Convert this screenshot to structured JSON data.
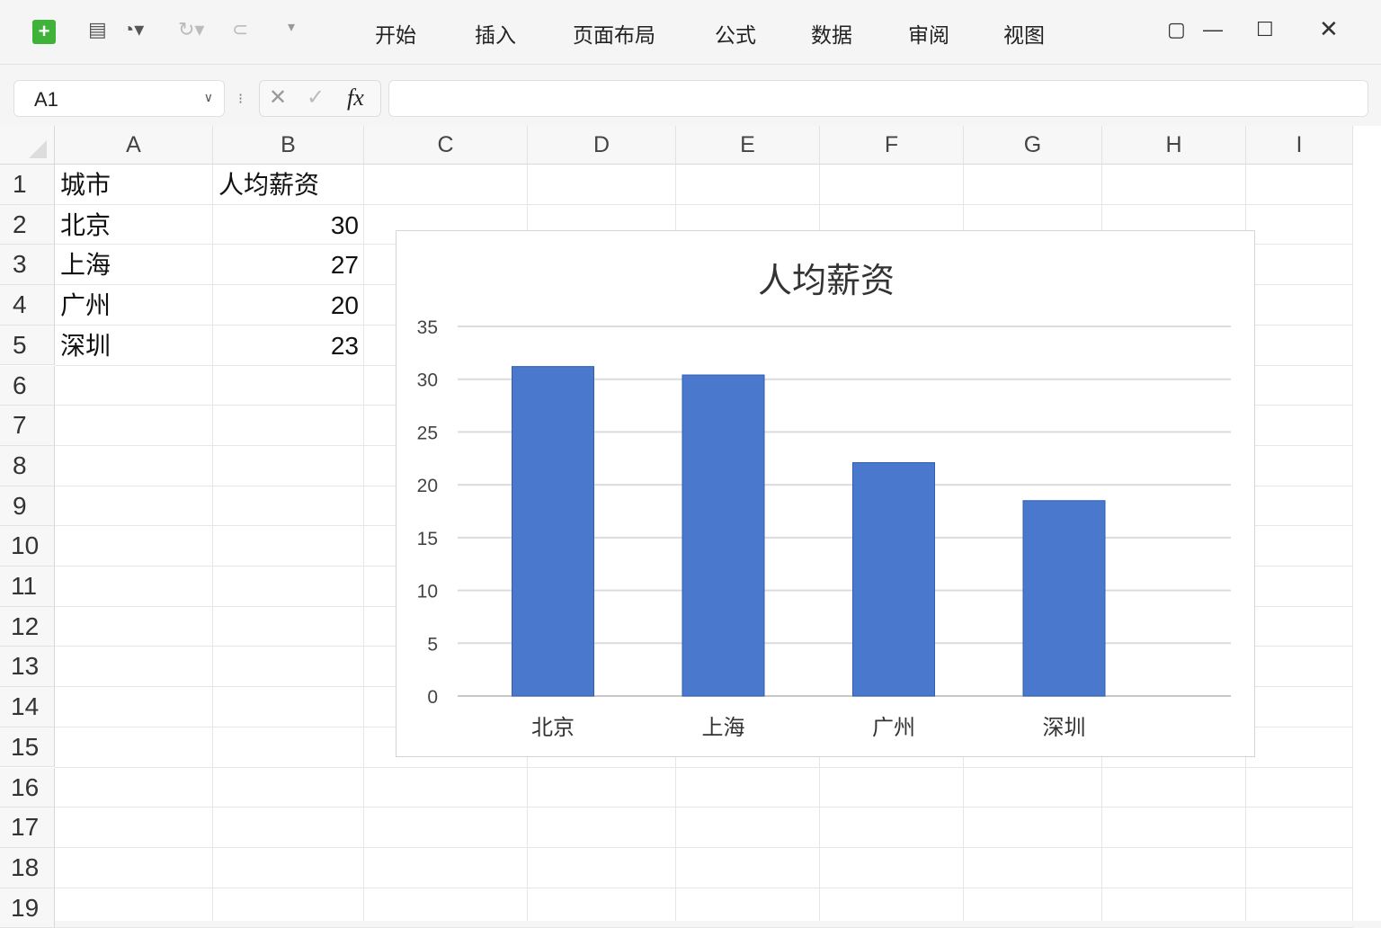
{
  "toolbar": {
    "menus": [
      "开始",
      "插入",
      "页面布局",
      "公式",
      "数据",
      "审阅",
      "视图"
    ]
  },
  "formula_bar": {
    "name_box": "A1",
    "fx": "fx",
    "value": ""
  },
  "columns": [
    "A",
    "B",
    "C",
    "D",
    "E",
    "F",
    "G",
    "H",
    "I"
  ],
  "rows": [
    "1",
    "2",
    "3",
    "4",
    "5",
    "6",
    "7",
    "8",
    "9",
    "10",
    "11",
    "12",
    "13",
    "14",
    "15",
    "16",
    "17",
    "18",
    "19"
  ],
  "cells": {
    "A1": "城市",
    "B1": "人均薪资",
    "A2": "北京",
    "B2": "30",
    "A3": "上海",
    "B3": "27",
    "A4": "广州",
    "B4": "20",
    "A5": "深圳",
    "B5": "23"
  },
  "chart_data": {
    "type": "bar",
    "title": "人均薪资",
    "categories": [
      "北京",
      "上海",
      "广州",
      "深圳"
    ],
    "values": [
      31.2,
      30.4,
      22.1,
      18.5
    ],
    "ylim": [
      0,
      35
    ],
    "yticks": [
      "0",
      "5",
      "10",
      "15",
      "20",
      "25",
      "30",
      "35"
    ],
    "grid": true,
    "color": "#4a78cc"
  }
}
